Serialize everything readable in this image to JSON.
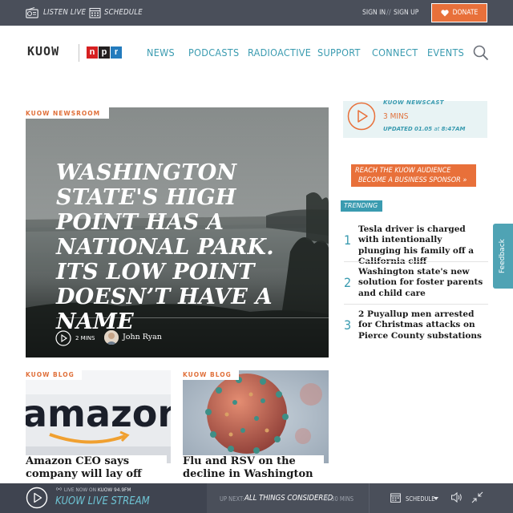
{
  "topbar": {
    "listen_live": "Listen Live",
    "schedule": "Schedule",
    "sign_in": "Sign In",
    "divider": "//",
    "sign_up": "Sign Up",
    "donate": "Donate"
  },
  "header": {
    "logo": "KUOW",
    "npr_letters": [
      "n",
      "p",
      "r"
    ],
    "npr_colors": [
      "#d62021",
      "#231f20",
      "#237bbd"
    ],
    "nav": [
      "News",
      "Podcasts",
      "RadioActive",
      "Support",
      "Connect",
      "Events"
    ]
  },
  "hero": {
    "tag": "KUOW Newsroom",
    "title": "Washington State's High Point Has a National Park. Its Low Point Doesn’t Have a Name",
    "duration": "2 Mins",
    "author": "John Ryan"
  },
  "newscast": {
    "label": "KUOW Newscast",
    "duration": "3 Mins",
    "updated_prefix": "Updated",
    "updated_date": "01.05",
    "updated_at": "at",
    "updated_time": "8:47AM"
  },
  "sponsor": {
    "line1": "Reach the KUOW audience",
    "line2": "Become a business sponsor »"
  },
  "trending": {
    "label": "Trending",
    "items": [
      {
        "num": "1",
        "title": "Tesla driver is charged with intentionally plunging his family off a California cliff"
      },
      {
        "num": "2",
        "title": "Washington state's new solution for foster parents and child care"
      },
      {
        "num": "3",
        "title": "2 Puyallup men arrested for Christmas attacks on Pierce County substations"
      }
    ]
  },
  "feedback": "Feedback",
  "cards": [
    {
      "tag": "KUOW Blog",
      "title": "Amazon CEO says company will lay off",
      "image_text": "amazon"
    },
    {
      "tag": "KUOW Blog",
      "title": "Flu and RSV on the decline in Washington"
    }
  ],
  "player": {
    "live_prefix": "Live now on",
    "station": "KUOW 94.9FM",
    "stream": "KUOW Live Stream",
    "up_next": "Up Next:",
    "show": "All Things Considered",
    "in_time": "In 30 Mins",
    "schedule": "Schedule"
  },
  "colors": {
    "teal": "#3a9bb0",
    "orange": "#e8703a",
    "dark_bar": "#4a4f5a"
  }
}
